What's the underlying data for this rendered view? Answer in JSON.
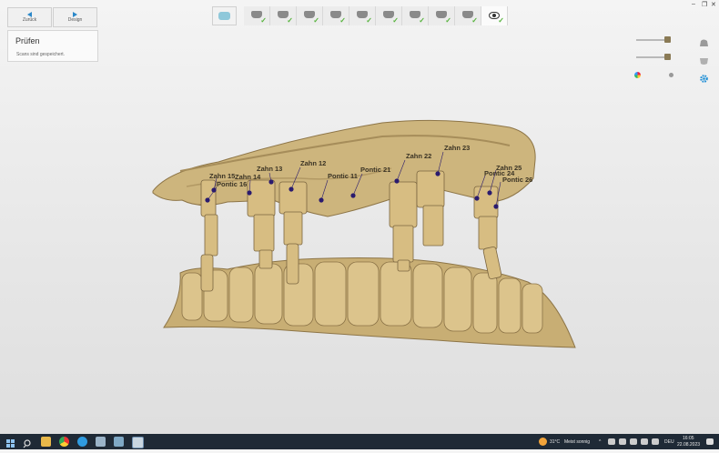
{
  "top_buttons": [
    {
      "label": "Zurück"
    },
    {
      "label": "Design"
    }
  ],
  "step_panel": {
    "title": "Prüfen",
    "status": "Scans sind gespeichert."
  },
  "toolbar": {
    "tools": [
      {
        "icon": "upper-jaw-scan-icon",
        "done": true
      },
      {
        "icon": "lower-jaw-scan-icon",
        "done": true
      },
      {
        "icon": "bite-scan-icon",
        "done": true
      },
      {
        "icon": "scanbody-icon",
        "done": true
      },
      {
        "icon": "scanbody-icon",
        "done": true
      },
      {
        "icon": "scanbody-icon",
        "done": true
      },
      {
        "icon": "scanbody-icon",
        "done": true
      },
      {
        "icon": "scanbody-icon",
        "done": true
      },
      {
        "icon": "scanbody-icon",
        "done": true
      },
      {
        "icon": "eye-icon",
        "done": true,
        "active": true
      }
    ],
    "check": "✓"
  },
  "window_controls": {
    "minimize": "–",
    "restore": "❐",
    "close": "✕"
  },
  "tooth_labels": [
    "Zahn 15",
    "Pontic 16",
    "Zahn 14",
    "Zahn 13",
    "Zahn 12",
    "Pontic 11",
    "Pontic 21",
    "Zahn 22",
    "Zahn 23",
    "Zahn 25",
    "Pontic 24",
    "Pontic 26"
  ],
  "taskbar": {
    "weather": {
      "temp": "31°C",
      "condition": "Meist sonnig"
    },
    "language": "DEU",
    "time": "16:05",
    "date": "22.08.2023"
  },
  "colors": {
    "model": "#c9b27a",
    "model_dark": "#9c8453",
    "marker": "#2a1b6e",
    "accent": "#1f8fd6",
    "check": "#55b33b"
  }
}
